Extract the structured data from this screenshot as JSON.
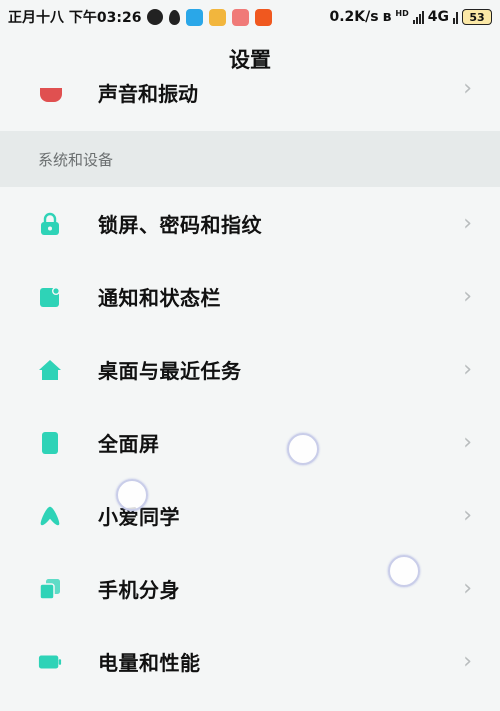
{
  "status_bar": {
    "date_time": "正月十八 下午03:26",
    "network_speed": "0.2K/s",
    "hd_label": "HD",
    "network_type": "4G",
    "battery": "53"
  },
  "page": {
    "title": "设置"
  },
  "partial_item": {
    "label": "声音和振动",
    "icon": "speaker-icon"
  },
  "section": {
    "title": "系统和设备"
  },
  "items": [
    {
      "label": "锁屏、密码和指纹",
      "icon": "lock-icon"
    },
    {
      "label": "通知和状态栏",
      "icon": "notification-icon"
    },
    {
      "label": "桌面与最近任务",
      "icon": "home-icon"
    },
    {
      "label": "全面屏",
      "icon": "fullscreen-icon"
    },
    {
      "label": "小爱同学",
      "icon": "xiaoai-icon"
    },
    {
      "label": "手机分身",
      "icon": "second-space-icon"
    },
    {
      "label": "电量和性能",
      "icon": "battery-icon"
    }
  ],
  "colors": {
    "accent": "#2ed3b7",
    "partial_icon": "#e05050",
    "background": "#f4f6f6",
    "section_bg": "#e6eaea"
  }
}
